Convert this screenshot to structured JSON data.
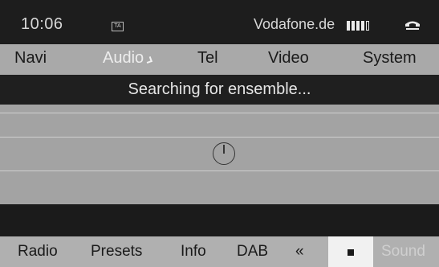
{
  "status": {
    "time": "10:06",
    "ta_label": "TA",
    "carrier": "Vodafone.de",
    "signal_bars_filled": 4,
    "signal_bars_total": 5
  },
  "main_menu": {
    "items": [
      {
        "label": "Navi"
      },
      {
        "label": "Audio",
        "active": true
      },
      {
        "label": "Tel"
      },
      {
        "label": "Video"
      },
      {
        "label": "System"
      }
    ]
  },
  "message": "Searching for ensemble...",
  "bottom_menu": {
    "items": [
      {
        "label": "Radio"
      },
      {
        "label": "Presets"
      },
      {
        "label": "Info"
      },
      {
        "label": "DAB"
      },
      {
        "label": "«"
      },
      {
        "label": "Sound",
        "dimmed": true
      }
    ]
  },
  "icons": {
    "ta": "ta-icon",
    "signal": "signal-strength-icon",
    "phone": "phone-handset-icon",
    "busy": "busy-indicator-icon",
    "stop": "stop-icon"
  }
}
